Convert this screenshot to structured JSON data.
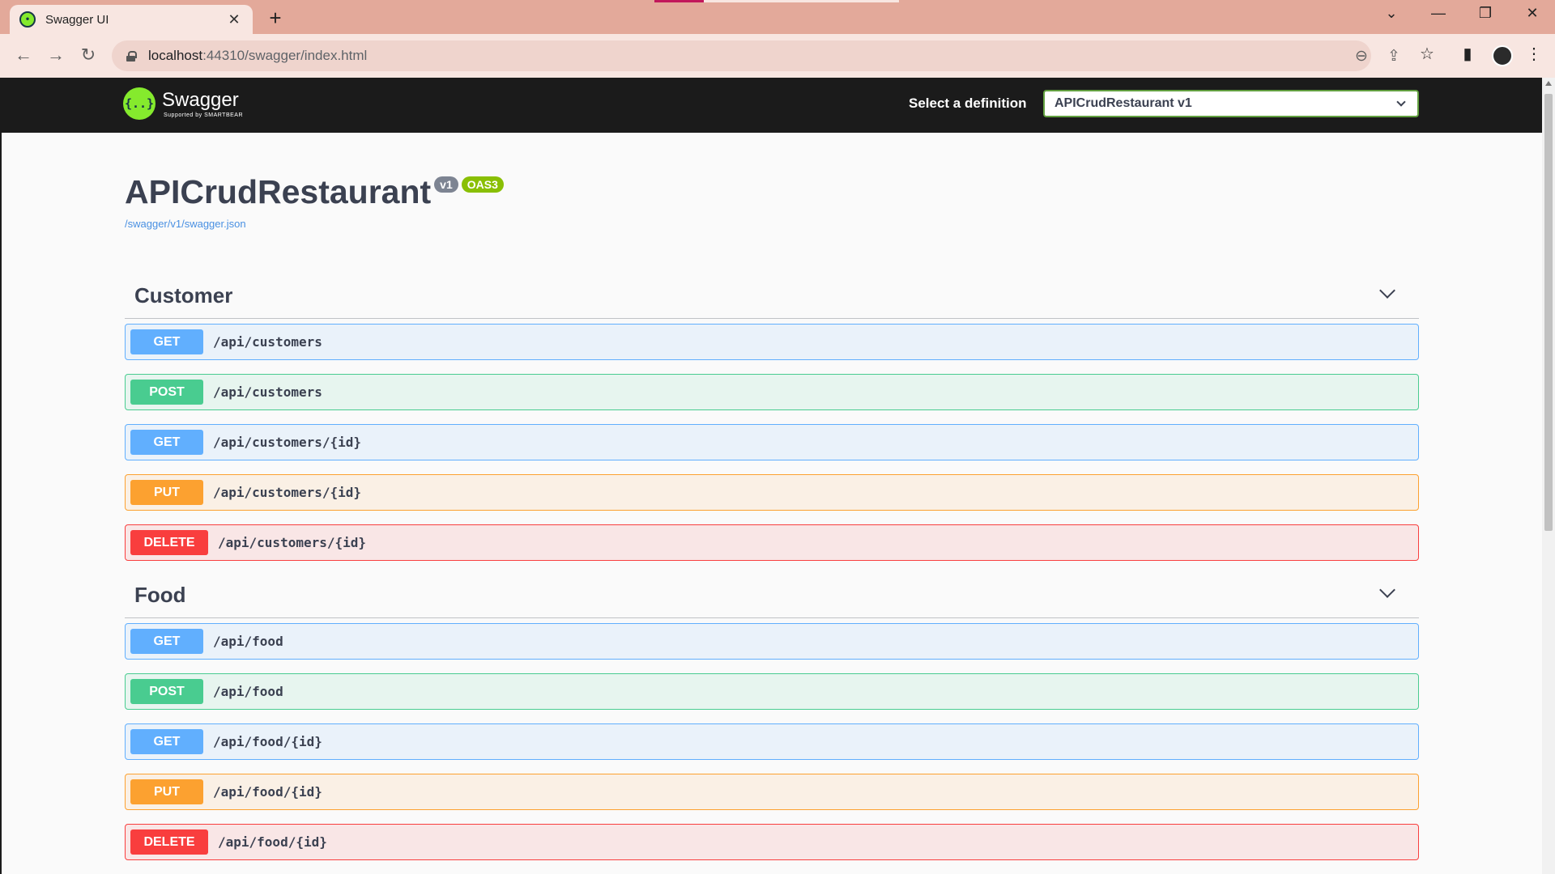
{
  "browser": {
    "tab_title": "Swagger UI",
    "tab_close": "✕",
    "new_tab": "+",
    "url_host": "localhost",
    "url_rest": ":44310/swagger/index.html",
    "window_controls": {
      "dropdown": "⌄",
      "minimize": "—",
      "restore": "❐",
      "close": "✕"
    },
    "nav": {
      "back": "←",
      "forward": "→",
      "reload": "↻"
    },
    "omni_icons": {
      "zoom": "⊖",
      "share": "⇪",
      "bookmark": "☆"
    },
    "toolbar_icons": {
      "sidepanel": "▮",
      "menu": "⋮"
    }
  },
  "swagger": {
    "logo_text": "Swagger",
    "logo_sub": "Supported by SMARTBEAR",
    "logo_glyph": "{..}",
    "definition_label": "Select a definition",
    "definition_value": "APICrudRestaurant v1"
  },
  "info": {
    "title": "APICrudRestaurant",
    "version_badge": "v1",
    "oas_badge": "OAS3",
    "spec_link": "/swagger/v1/swagger.json"
  },
  "tags": [
    {
      "name": "Customer",
      "operations": [
        {
          "method": "GET",
          "path": "/api/customers"
        },
        {
          "method": "POST",
          "path": "/api/customers"
        },
        {
          "method": "GET",
          "path": "/api/customers/{id}"
        },
        {
          "method": "PUT",
          "path": "/api/customers/{id}"
        },
        {
          "method": "DELETE",
          "path": "/api/customers/{id}"
        }
      ]
    },
    {
      "name": "Food",
      "operations": [
        {
          "method": "GET",
          "path": "/api/food"
        },
        {
          "method": "POST",
          "path": "/api/food"
        },
        {
          "method": "GET",
          "path": "/api/food/{id}"
        },
        {
          "method": "PUT",
          "path": "/api/food/{id}"
        },
        {
          "method": "DELETE",
          "path": "/api/food/{id}"
        }
      ]
    }
  ],
  "colors": {
    "get": "#61affe",
    "post": "#49cc90",
    "put": "#fca130",
    "delete": "#f93e3e",
    "topbar": "#1b1b1b",
    "logo_green": "#85ea2d"
  }
}
